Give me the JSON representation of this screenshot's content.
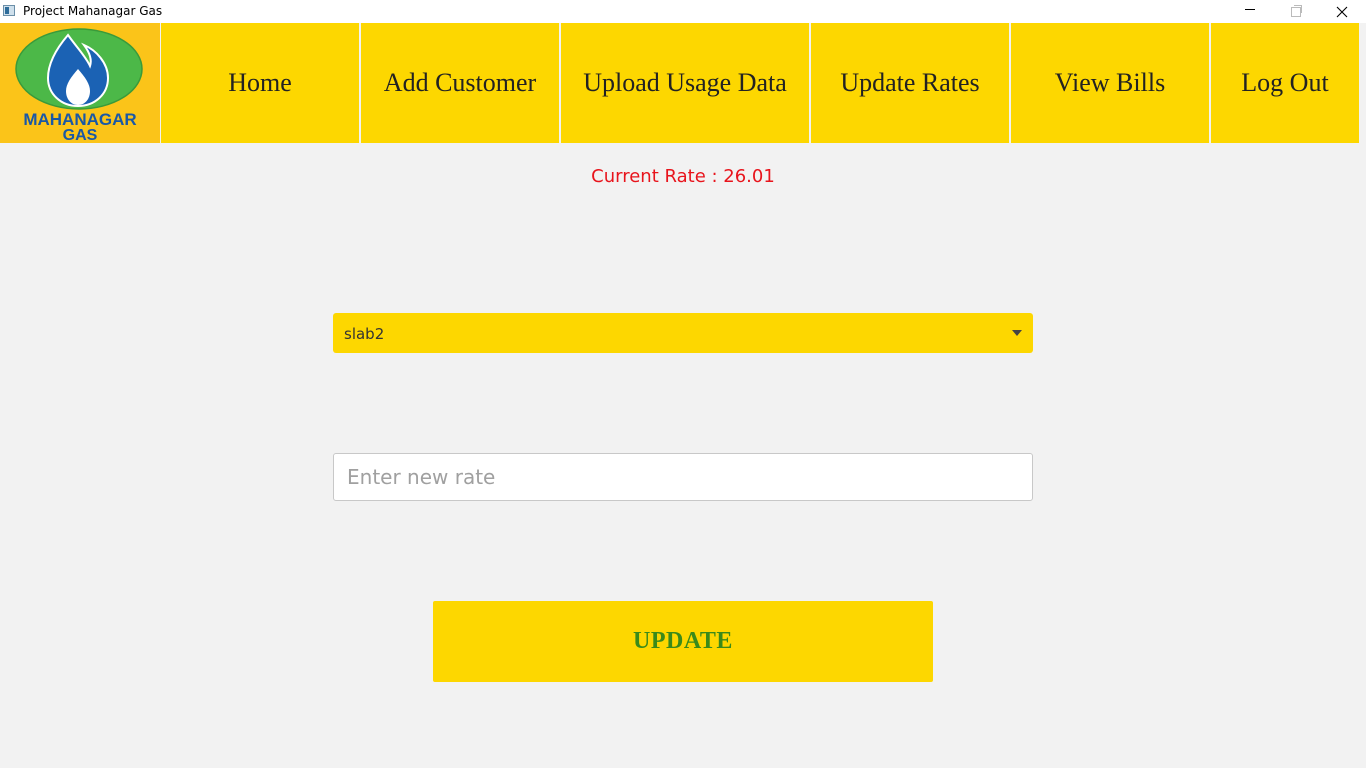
{
  "window": {
    "title": "Project Mahanagar Gas",
    "controls": [
      "minimize",
      "maximize",
      "close"
    ]
  },
  "logo": {
    "text_line1": "MAHANAGAR",
    "text_line2": "GAS",
    "colors": {
      "background": "#fbc419",
      "ellipse": "#4cb848",
      "flame": "#1b62b4",
      "text": "#1a58a6"
    }
  },
  "nav": {
    "items": [
      {
        "label": "Home"
      },
      {
        "label": "Add Customer"
      },
      {
        "label": "Upload Usage Data"
      },
      {
        "label": "Update Rates"
      },
      {
        "label": "View Bills"
      },
      {
        "label": "Log Out"
      }
    ]
  },
  "main": {
    "current_rate_text": "Current Rate : 26.01",
    "slab_select": {
      "selected": "slab2",
      "icon": "chevron-down-icon"
    },
    "rate_input": {
      "value": "",
      "placeholder": "Enter new rate"
    },
    "update_button": "UPDATE"
  },
  "colors": {
    "nav_bg": "#fdd700",
    "page_bg": "#f2f2f2",
    "rate_text": "#e8141c",
    "button_text": "#3a8a1a"
  }
}
